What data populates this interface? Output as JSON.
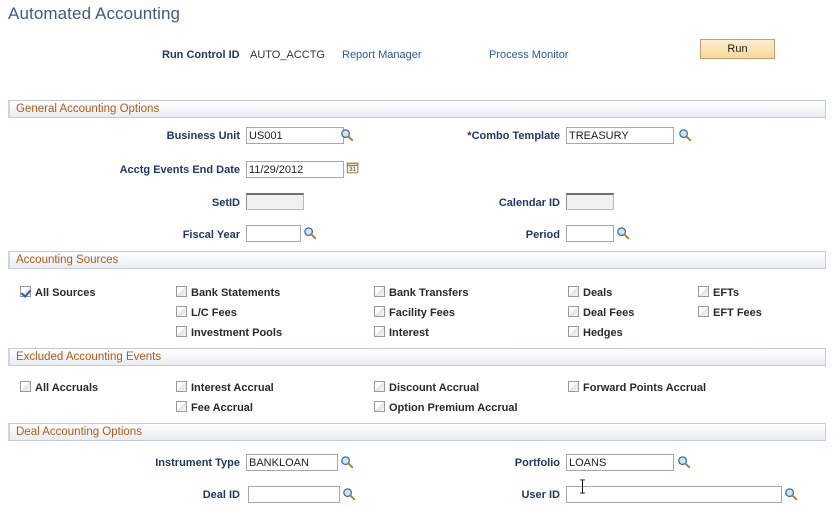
{
  "page": {
    "title": "Automated Accounting"
  },
  "run_control": {
    "label": "Run Control ID",
    "value": "AUTO_ACCTG",
    "report_manager_link": "Report Manager",
    "process_monitor_link": "Process Monitor",
    "run_button": "Run"
  },
  "sections": {
    "general": {
      "title": "General Accounting Options",
      "fields": {
        "business_unit": {
          "label": "Business Unit",
          "value": "US001",
          "icon": "magnifier-icon"
        },
        "combo_template": {
          "label": "*Combo Template",
          "value": "TREASURY",
          "icon": "magnifier-icon"
        },
        "acctg_events_end_date": {
          "label": "Acctg Events End Date",
          "value": "11/29/2012",
          "icon": "calendar-icon"
        },
        "setid": {
          "label": "SetID",
          "value": "",
          "disabled": true
        },
        "calendar_id": {
          "label": "Calendar ID",
          "value": "",
          "disabled": true
        },
        "fiscal_year": {
          "label": "Fiscal Year",
          "value": "",
          "icon": "magnifier-icon"
        },
        "period": {
          "label": "Period",
          "value": "",
          "icon": "magnifier-icon"
        }
      }
    },
    "accounting_sources": {
      "title": "Accounting Sources",
      "all": {
        "label": "All Sources",
        "checked": true
      },
      "columns": [
        [
          {
            "label": "Bank Statements",
            "checked": false
          },
          {
            "label": "L/C Fees",
            "checked": false
          },
          {
            "label": "Investment Pools",
            "checked": false
          }
        ],
        [
          {
            "label": "Bank Transfers",
            "checked": false
          },
          {
            "label": "Facility Fees",
            "checked": false
          },
          {
            "label": "Interest",
            "checked": false
          }
        ],
        [
          {
            "label": "Deals",
            "checked": false
          },
          {
            "label": "Deal Fees",
            "checked": false
          },
          {
            "label": "Hedges",
            "checked": false
          }
        ],
        [
          {
            "label": "EFTs",
            "checked": false
          },
          {
            "label": "EFT Fees",
            "checked": false
          }
        ]
      ]
    },
    "excluded_events": {
      "title": "Excluded Accounting Events",
      "all": {
        "label": "All Accruals",
        "checked": false
      },
      "columns": [
        [
          {
            "label": "Interest Accrual",
            "checked": false
          },
          {
            "label": "Fee Accrual",
            "checked": false
          }
        ],
        [
          {
            "label": "Discount Accrual",
            "checked": false
          },
          {
            "label": "Option Premium Accrual",
            "checked": false
          }
        ],
        [
          {
            "label": "Forward Points Accrual",
            "checked": false
          }
        ]
      ]
    },
    "deal_options": {
      "title": "Deal Accounting Options",
      "fields": {
        "instrument_type": {
          "label": "Instrument Type",
          "value": "BANKLOAN",
          "icon": "magnifier-icon"
        },
        "portfolio": {
          "label": "Portfolio",
          "value": "LOANS",
          "icon": "magnifier-icon"
        },
        "deal_id": {
          "label": "Deal ID",
          "value": "",
          "icon": "magnifier-icon"
        },
        "user_id": {
          "label": "User ID",
          "value": "",
          "icon": "magnifier-icon"
        }
      }
    }
  },
  "colors": {
    "title_blue": "#3f5a8a",
    "label_navy": "#1f3864",
    "section_orange": "#b55a14",
    "link_blue": "#2c5aa0",
    "run_button_gold": "#f6d79c"
  }
}
